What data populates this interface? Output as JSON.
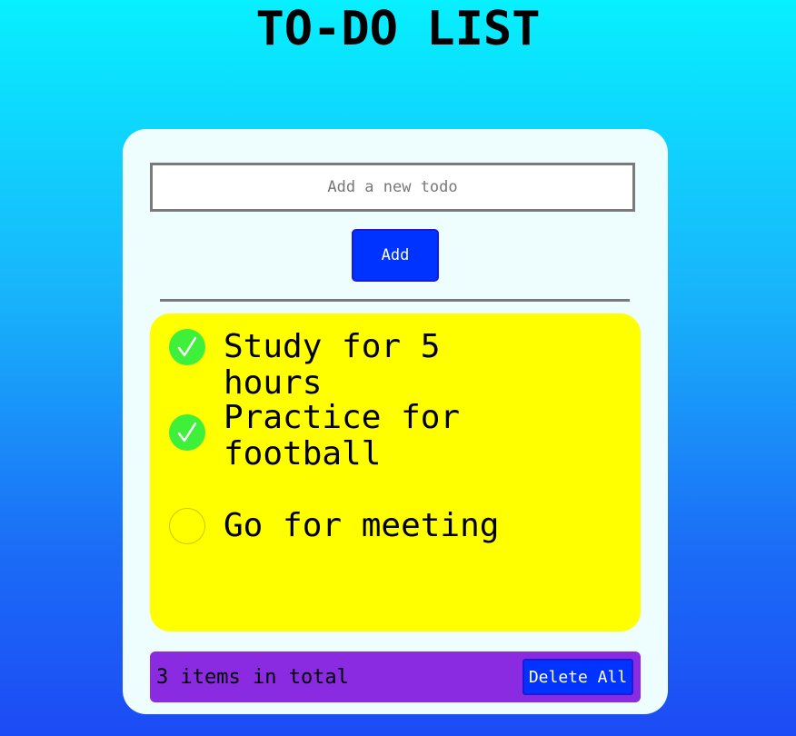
{
  "header": {
    "title": "TO-DO LIST"
  },
  "form": {
    "input_placeholder": "Add a new todo",
    "input_value": "",
    "add_label": "Add"
  },
  "todos": [
    {
      "text": "Study for 5 hours",
      "completed": true,
      "check_icon": "check-circle-icon"
    },
    {
      "text": "Practice for football",
      "completed": true,
      "check_icon": "check-circle-icon"
    },
    {
      "text": "Go for meeting",
      "completed": false,
      "check_icon": "empty-circle-icon"
    }
  ],
  "footer": {
    "count_text": "3 items in total",
    "delete_all_label": "Delete All"
  },
  "colors": {
    "list_background": "#ffff00",
    "footer_background": "#8a2be2",
    "button_background": "#0033ff",
    "check_done": "#3ef03a"
  }
}
